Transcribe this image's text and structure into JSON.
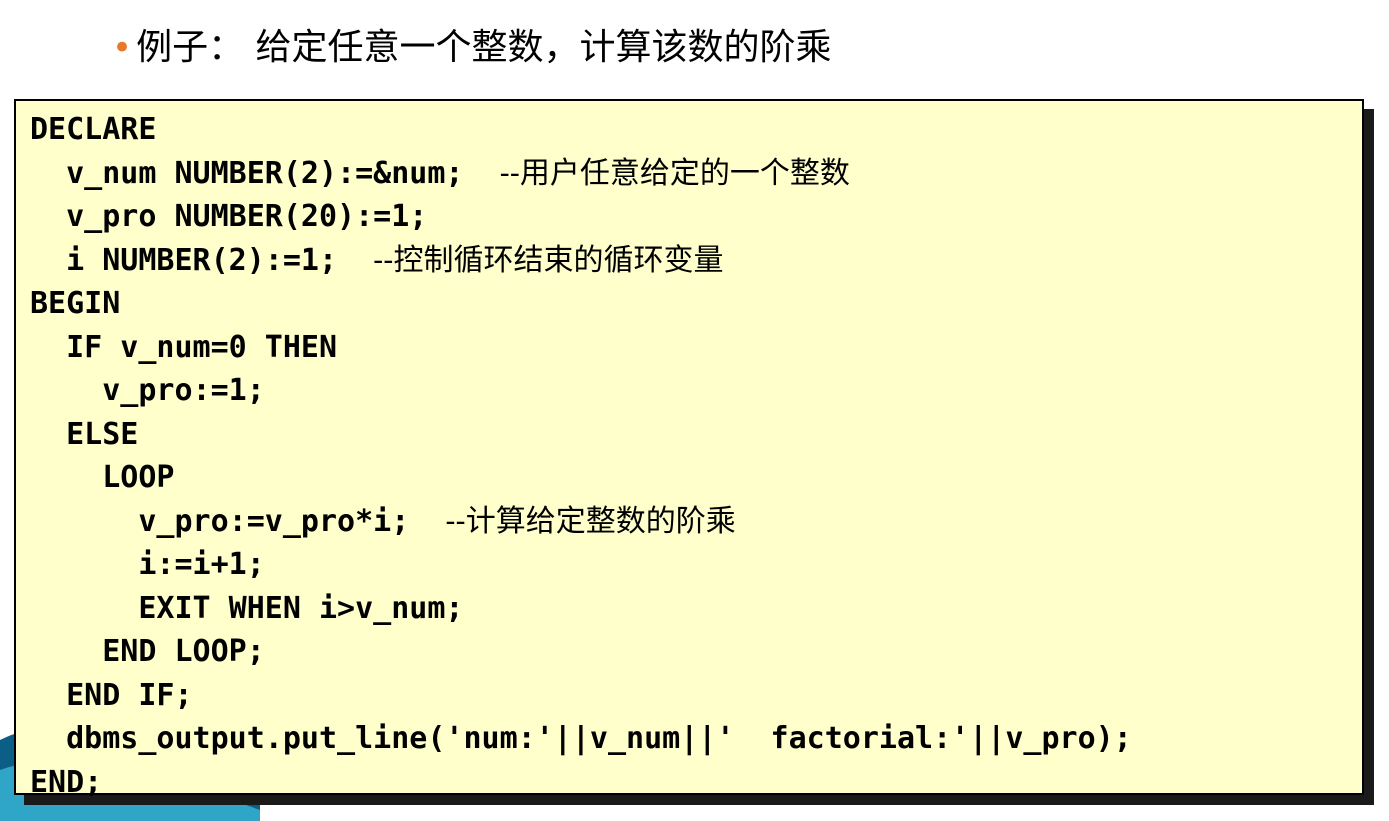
{
  "title": {
    "bullet": "•",
    "text": "例子： 给定任意一个整数，计算该数的阶乘"
  },
  "code_lines": [
    {
      "code": "DECLARE",
      "comment": ""
    },
    {
      "code": "  v_num NUMBER(2):=&num;  ",
      "comment": "--用户任意给定的一个整数"
    },
    {
      "code": "  v_pro NUMBER(20):=1;",
      "comment": ""
    },
    {
      "code": "  i NUMBER(2):=1;  ",
      "comment": "--控制循环结束的循环变量"
    },
    {
      "code": "BEGIN",
      "comment": ""
    },
    {
      "code": "  IF v_num=0 THEN",
      "comment": ""
    },
    {
      "code": "    v_pro:=1;",
      "comment": ""
    },
    {
      "code": "  ELSE",
      "comment": ""
    },
    {
      "code": "    LOOP",
      "comment": ""
    },
    {
      "code": "      v_pro:=v_pro*i;  ",
      "comment": "--计算给定整数的阶乘"
    },
    {
      "code": "      i:=i+1;",
      "comment": ""
    },
    {
      "code": "      EXIT WHEN i>v_num;",
      "comment": ""
    },
    {
      "code": "    END LOOP;",
      "comment": ""
    },
    {
      "code": "  END IF;",
      "comment": ""
    },
    {
      "code": "  dbms_output.put_line('num:'||v_num||'  factorial:'||v_pro);",
      "comment": ""
    },
    {
      "code": "END;",
      "comment": ""
    }
  ],
  "colors": {
    "bullet": "#e8782a",
    "code_background": "#ffffcc",
    "wave_dark": "#0b5f86",
    "wave_light": "#2fa6c8"
  }
}
